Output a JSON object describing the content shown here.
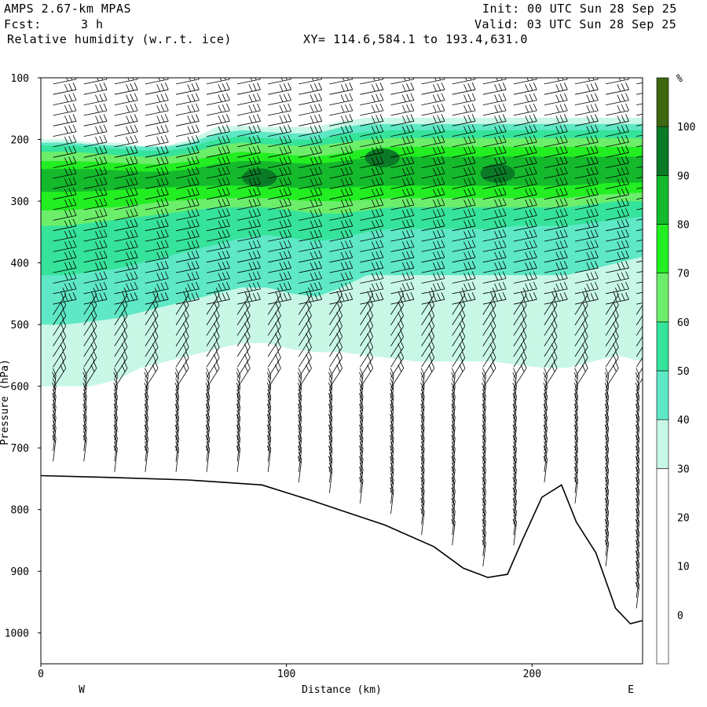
{
  "header": {
    "model": "AMPS 2.67-km MPAS",
    "init": "Init: 00 UTC Sun 28 Sep 25",
    "fcst_label": "Fcst:",
    "fcst_value": "3 h",
    "valid": "Valid: 03 UTC Sun 28 Sep 25",
    "field": "Relative humidity (w.r.t. ice)",
    "xy": "XY= 114.6,584.1 to 193.4,631.0"
  },
  "chart_data": {
    "type": "heatmap",
    "title": "Relative humidity (w.r.t. ice)",
    "xlabel": "Distance (km)",
    "ylabel": "Pressure (hPa)",
    "xlim": [
      0,
      245
    ],
    "ylim": [
      1050,
      100
    ],
    "x_ticks": [
      0,
      100,
      200
    ],
    "y_ticks": [
      100,
      200,
      300,
      400,
      500,
      600,
      700,
      800,
      900,
      1000
    ],
    "left_end_label": "W",
    "right_end_label": "E",
    "colorbar": {
      "unit": "%",
      "ticks": [
        0,
        10,
        20,
        30,
        40,
        50,
        60,
        70,
        80,
        90,
        100
      ],
      "levels": [
        {
          "from": -10,
          "to": 30,
          "color": "#ffffff"
        },
        {
          "from": 30,
          "to": 40,
          "color": "#c8f7e6"
        },
        {
          "from": 40,
          "to": 50,
          "color": "#5ee8c6"
        },
        {
          "from": 50,
          "to": 60,
          "color": "#36e39a"
        },
        {
          "from": 60,
          "to": 70,
          "color": "#6cee6a"
        },
        {
          "from": 70,
          "to": 80,
          "color": "#22ee22"
        },
        {
          "from": 80,
          "to": 90,
          "color": "#14b92c"
        },
        {
          "from": 90,
          "to": 100,
          "color": "#0a7a26"
        },
        {
          "from": 100,
          "to": 110,
          "color": "#3e6712"
        }
      ]
    },
    "bands": [
      {
        "level": 35,
        "top": [
          200,
          200,
          205,
          205,
          210,
          210,
          200,
          180,
          178,
          180,
          180,
          180,
          170,
          165,
          165,
          165,
          165,
          165,
          165,
          165,
          165,
          165,
          165,
          165,
          165
        ],
        "bottom": [
          600,
          600,
          600,
          590,
          570,
          560,
          550,
          540,
          530,
          530,
          540,
          545,
          545,
          550,
          555,
          560,
          560,
          560,
          560,
          565,
          570,
          570,
          560,
          550,
          560
        ]
      },
      {
        "level": 45,
        "top": [
          205,
          205,
          208,
          210,
          212,
          212,
          205,
          190,
          185,
          188,
          190,
          190,
          180,
          175,
          175,
          175,
          175,
          175,
          175,
          175,
          175,
          175,
          175,
          175,
          175
        ],
        "bottom": [
          500,
          500,
          495,
          490,
          480,
          470,
          460,
          450,
          440,
          440,
          450,
          455,
          440,
          420,
          420,
          420,
          420,
          420,
          420,
          420,
          420,
          420,
          410,
          400,
          390
        ]
      },
      {
        "level": 55,
        "top": [
          210,
          210,
          212,
          215,
          218,
          218,
          212,
          200,
          195,
          198,
          200,
          200,
          192,
          188,
          185,
          185,
          185,
          185,
          185,
          185,
          185,
          185,
          185,
          185,
          185
        ],
        "bottom": [
          420,
          420,
          415,
          410,
          400,
          390,
          380,
          370,
          360,
          355,
          360,
          365,
          360,
          350,
          345,
          345,
          345,
          345,
          345,
          340,
          340,
          340,
          335,
          330,
          325
        ]
      },
      {
        "level": 65,
        "top": [
          220,
          220,
          222,
          225,
          228,
          228,
          222,
          210,
          205,
          208,
          210,
          210,
          205,
          200,
          198,
          198,
          198,
          198,
          198,
          198,
          198,
          198,
          198,
          198,
          198
        ],
        "bottom": [
          340,
          340,
          335,
          330,
          325,
          320,
          315,
          310,
          310,
          310,
          315,
          320,
          320,
          315,
          310,
          310,
          310,
          310,
          310,
          310,
          310,
          310,
          305,
          300,
          300
        ]
      },
      {
        "level": 75,
        "top": [
          235,
          235,
          236,
          238,
          240,
          240,
          235,
          225,
          220,
          222,
          225,
          228,
          222,
          215,
          212,
          212,
          212,
          212,
          212,
          212,
          212,
          212,
          212,
          212,
          212
        ],
        "bottom": [
          315,
          315,
          312,
          310,
          305,
          300,
          298,
          295,
          295,
          295,
          298,
          300,
          300,
          298,
          295,
          295,
          295,
          295,
          295,
          295,
          295,
          295,
          290,
          288,
          286
        ]
      },
      {
        "level": 85,
        "top": [
          248,
          248,
          248,
          250,
          252,
          252,
          248,
          240,
          235,
          235,
          238,
          240,
          235,
          230,
          228,
          228,
          228,
          228,
          228,
          228,
          228,
          228,
          228,
          228,
          228
        ],
        "bottom": [
          285,
          285,
          284,
          282,
          280,
          278,
          276,
          275,
          275,
          276,
          278,
          280,
          278,
          276,
          275,
          275,
          275,
          275,
          275,
          275,
          275,
          275,
          272,
          270,
          270
        ]
      }
    ],
    "blobs": [
      {
        "level": 95,
        "x": 89,
        "p": 262
      },
      {
        "level": 95,
        "x": 139,
        "p": 230
      },
      {
        "level": 95,
        "x": 186,
        "p": 255
      }
    ],
    "terrain": {
      "distance_km": [
        0,
        30,
        60,
        90,
        110,
        125,
        140,
        160,
        172,
        182,
        190,
        196,
        204,
        212,
        218,
        226,
        234,
        240,
        245
      ],
      "pressure_hpa": [
        745,
        748,
        752,
        760,
        785,
        805,
        825,
        860,
        895,
        910,
        905,
        850,
        780,
        760,
        820,
        870,
        960,
        985,
        980
      ]
    }
  }
}
